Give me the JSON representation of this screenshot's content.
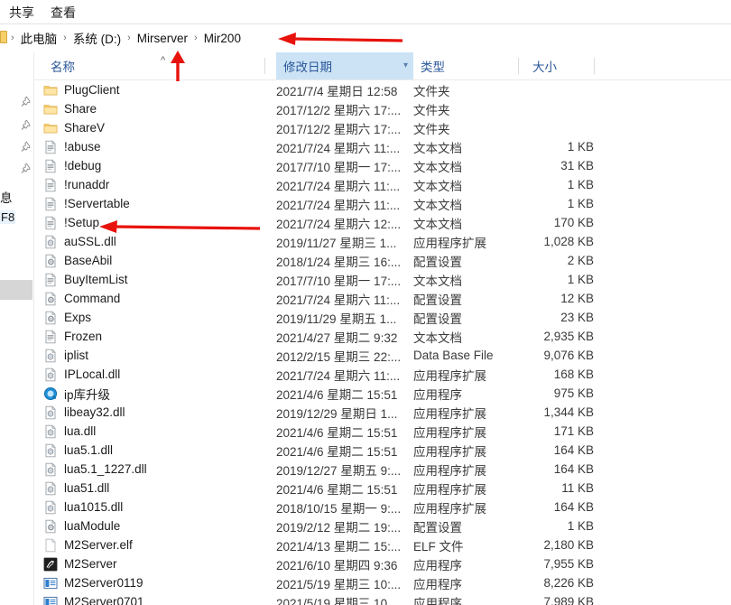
{
  "ribbon": {
    "tabs": [
      {
        "label": "共享",
        "name": "tab-share"
      },
      {
        "label": "查看",
        "name": "tab-view"
      }
    ]
  },
  "address_bar": {
    "crumbs": [
      "此电脑",
      "系统 (D:)",
      "Mirserver",
      "Mir200"
    ],
    "separator": "›"
  },
  "nav_pane": {
    "partial_label": "息",
    "shortcut_hint": "F8"
  },
  "columns": {
    "name": "名称",
    "date_modified": "修改日期",
    "type": "类型",
    "size": "大小",
    "sorted_column": "修改日期",
    "sort_highlight_color": "#cce3f6",
    "header_text_color": "#2b579a"
  },
  "files": [
    {
      "name": "PlugClient",
      "icon": "folder-icon",
      "date": "2021/7/4 星期日 12:58",
      "type": "文件夹",
      "size": ""
    },
    {
      "name": "Share",
      "icon": "folder-icon",
      "date": "2017/12/2 星期六 17:...",
      "type": "文件夹",
      "size": ""
    },
    {
      "name": "ShareV",
      "icon": "folder-icon",
      "date": "2017/12/2 星期六 17:...",
      "type": "文件夹",
      "size": ""
    },
    {
      "name": "!abuse",
      "icon": "text-file-icon",
      "date": "2021/7/24 星期六 11:...",
      "type": "文本文档",
      "size": "1 KB"
    },
    {
      "name": "!debug",
      "icon": "text-file-icon",
      "date": "2017/7/10 星期一 17:...",
      "type": "文本文档",
      "size": "31 KB"
    },
    {
      "name": "!runaddr",
      "icon": "text-file-icon",
      "date": "2021/7/24 星期六 11:...",
      "type": "文本文档",
      "size": "1 KB"
    },
    {
      "name": "!Servertable",
      "icon": "text-file-icon",
      "date": "2021/7/24 星期六 11:...",
      "type": "文本文档",
      "size": "1 KB"
    },
    {
      "name": "!Setup",
      "icon": "text-file-icon",
      "date": "2021/7/24 星期六 12:...",
      "type": "文本文档",
      "size": "170 KB"
    },
    {
      "name": "auSSL.dll",
      "icon": "dll-file-icon",
      "date": "2019/11/27 星期三 1...",
      "type": "应用程序扩展",
      "size": "1,028 KB"
    },
    {
      "name": "BaseAbil",
      "icon": "config-file-icon",
      "date": "2018/1/24 星期三 16:...",
      "type": "配置设置",
      "size": "2 KB"
    },
    {
      "name": "BuyItemList",
      "icon": "text-file-icon",
      "date": "2017/7/10 星期一 17:...",
      "type": "文本文档",
      "size": "1 KB"
    },
    {
      "name": "Command",
      "icon": "config-file-icon",
      "date": "2021/7/24 星期六 11:...",
      "type": "配置设置",
      "size": "12 KB"
    },
    {
      "name": "Exps",
      "icon": "config-file-icon",
      "date": "2019/11/29 星期五 1...",
      "type": "配置设置",
      "size": "23 KB"
    },
    {
      "name": "Frozen",
      "icon": "text-file-icon",
      "date": "2021/4/27 星期二 9:32",
      "type": "文本文档",
      "size": "2,935 KB"
    },
    {
      "name": "iplist",
      "icon": "dll-file-icon",
      "date": "2012/2/15 星期三 22:...",
      "type": "Data Base File",
      "size": "9,076 KB"
    },
    {
      "name": "IPLocal.dll",
      "icon": "dll-file-icon",
      "date": "2021/7/24 星期六 11:...",
      "type": "应用程序扩展",
      "size": "168 KB"
    },
    {
      "name": "ip库升级",
      "icon": "blue-globe-app-icon",
      "date": "2021/4/6 星期二 15:51",
      "type": "应用程序",
      "size": "975 KB"
    },
    {
      "name": "libeay32.dll",
      "icon": "dll-file-icon",
      "date": "2019/12/29 星期日 1...",
      "type": "应用程序扩展",
      "size": "1,344 KB"
    },
    {
      "name": "lua.dll",
      "icon": "dll-file-icon",
      "date": "2021/4/6 星期二 15:51",
      "type": "应用程序扩展",
      "size": "171 KB"
    },
    {
      "name": "lua5.1.dll",
      "icon": "dll-file-icon",
      "date": "2021/4/6 星期二 15:51",
      "type": "应用程序扩展",
      "size": "164 KB"
    },
    {
      "name": "lua5.1_1227.dll",
      "icon": "dll-file-icon",
      "date": "2019/12/27 星期五 9:...",
      "type": "应用程序扩展",
      "size": "164 KB"
    },
    {
      "name": "lua51.dll",
      "icon": "dll-file-icon",
      "date": "2021/4/6 星期二 15:51",
      "type": "应用程序扩展",
      "size": "11 KB"
    },
    {
      "name": "lua1015.dll",
      "icon": "dll-file-icon",
      "date": "2018/10/15 星期一 9:...",
      "type": "应用程序扩展",
      "size": "164 KB"
    },
    {
      "name": "luaModule",
      "icon": "config-file-icon",
      "date": "2019/2/12 星期二 19:...",
      "type": "配置设置",
      "size": "1 KB"
    },
    {
      "name": "M2Server.elf",
      "icon": "blank-file-icon",
      "date": "2021/4/13 星期二 15:...",
      "type": "ELF 文件",
      "size": "2,180 KB"
    },
    {
      "name": "M2Server",
      "icon": "m2server-app-icon",
      "date": "2021/6/10 星期四 9:36",
      "type": "应用程序",
      "size": "7,955 KB"
    },
    {
      "name": "M2Server0119",
      "icon": "blue-app-icon",
      "date": "2021/5/19 星期三 10:...",
      "type": "应用程序",
      "size": "8,226 KB"
    },
    {
      "name": "M2Server0701",
      "icon": "blue-app-icon",
      "date": "2021/5/19 星期三 10...",
      "type": "应用程序",
      "size": "7,989 KB"
    }
  ],
  "annotations": {
    "color": "#e8120c",
    "arrows": [
      {
        "name": "arrow-to-breadcrumb",
        "direction": "left"
      },
      {
        "name": "arrow-to-collapse-caret",
        "direction": "up"
      },
      {
        "name": "arrow-to-setup-file",
        "direction": "left"
      }
    ]
  }
}
